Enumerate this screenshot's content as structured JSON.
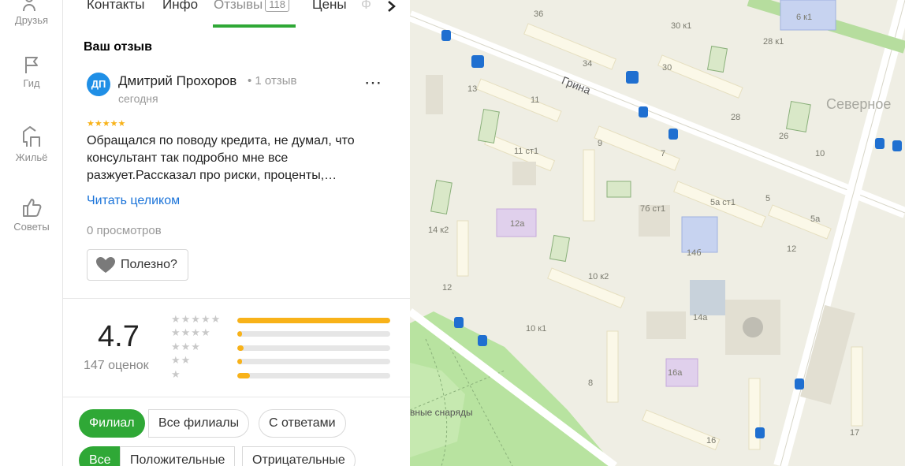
{
  "rail": [
    {
      "label": "Друзья",
      "icon": "friends-icon"
    },
    {
      "label": "Гид",
      "icon": "flag-icon"
    },
    {
      "label": "Жильё",
      "icon": "house-icon"
    },
    {
      "label": "Советы",
      "icon": "thumbs-up-icon"
    }
  ],
  "tabs": {
    "contacts": "Контакты",
    "info": "Инфо",
    "reviews": "Отзывы",
    "reviews_count": "118",
    "prices": "Цены",
    "truncated": "Ф"
  },
  "review": {
    "section_title": "Ваш отзыв",
    "avatar_initials": "ДП",
    "author": "Дмитрий Прохоров",
    "author_reviews": "• 1 отзыв",
    "date": "сегодня",
    "stars": "★★★★★",
    "rating": 5,
    "text": "Обращался по поводу кредита, не думал, что консультант так подробно мне все разжует.Рассказал про риски, проценты,…",
    "read_more": "Читать целиком",
    "views": "0 просмотров",
    "useful": "Полезно?",
    "more_icon": "more-dots-icon"
  },
  "summary": {
    "rating": "4.7",
    "count_label": "147 оценок",
    "distribution": [
      {
        "stars": "★★★★★",
        "fraction": 1.0
      },
      {
        "stars": "★★★★",
        "fraction": 0.03
      },
      {
        "stars": "★★★",
        "fraction": 0.04
      },
      {
        "stars": "★★",
        "fraction": 0.03
      },
      {
        "stars": "★",
        "fraction": 0.08
      }
    ]
  },
  "filters": {
    "scope": [
      "Филиал",
      "Все филиалы",
      "С ответами"
    ],
    "scope_selected": "Филиал",
    "type": [
      "Все",
      "Положительные",
      "Отрицательные"
    ],
    "type_selected": "Все"
  },
  "map": {
    "street": "Грина",
    "district": "Северное",
    "poi": "вные снаряды",
    "labels": [
      "36",
      "30 к1",
      "6 к1",
      "28 к1",
      "34",
      "30",
      "13",
      "11",
      "28",
      "26",
      "10",
      "11 ст1",
      "9",
      "7",
      "5а ст1",
      "5",
      "5а",
      "14 к2",
      "12а",
      "7б ст1",
      "14б",
      "12",
      "10 к2",
      "12",
      "14а",
      "10 к1",
      "8",
      "16а",
      "17",
      "16"
    ]
  },
  "colors": {
    "accent": "#2fa836",
    "star": "#f8b219",
    "link": "#1a73d9",
    "avatar": "#1f8fe6"
  }
}
